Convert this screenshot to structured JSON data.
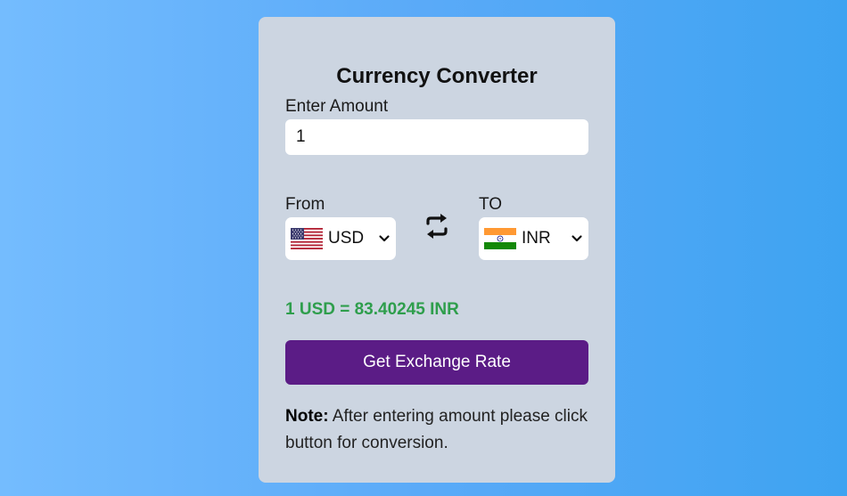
{
  "app": {
    "title": "Currency Converter"
  },
  "amount": {
    "label": "Enter Amount",
    "value": "1"
  },
  "from": {
    "label": "From",
    "currency": "USD",
    "flag": "us-flag"
  },
  "to": {
    "label": "TO",
    "currency": "INR",
    "flag": "in-flag"
  },
  "swap_icon": "swap-arrows-icon",
  "result": {
    "text": "1 USD = 83.40245 INR"
  },
  "button": {
    "label": "Get Exchange Rate"
  },
  "note": {
    "prefix": "Note:",
    "text": " After entering amount please click button for conversion."
  },
  "colors": {
    "card": "#ccd5e1",
    "button": "#5b1c86",
    "result": "#2e9e4c",
    "background_left": "#74bcfe",
    "background_right": "#3ea3f1"
  }
}
